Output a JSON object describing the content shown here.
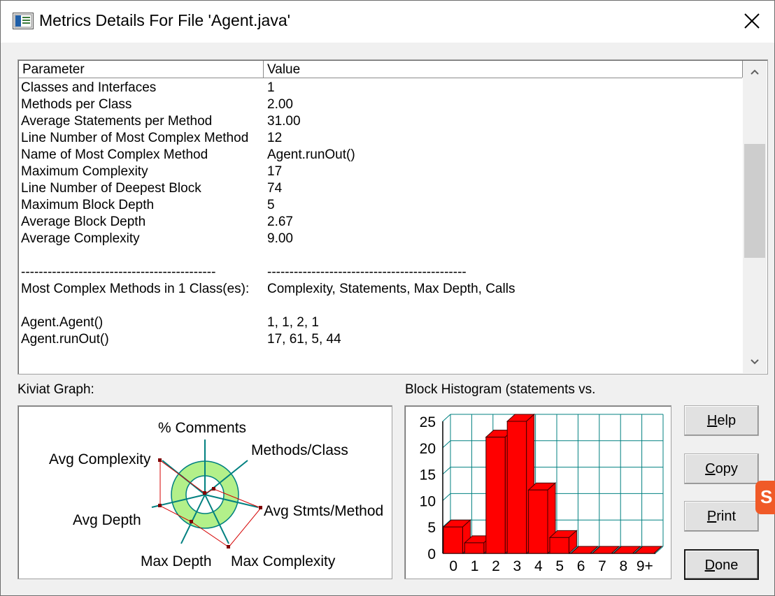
{
  "window": {
    "title": "Metrics Details For File 'Agent.java'",
    "icons": {
      "app": "app-window-icon",
      "close": "close-icon"
    }
  },
  "table": {
    "headers": {
      "parameter": "Parameter",
      "value": "Value"
    },
    "rows": [
      {
        "param": "Classes and Interfaces",
        "value": "1"
      },
      {
        "param": "Methods per Class",
        "value": "2.00"
      },
      {
        "param": "Average Statements per Method",
        "value": "31.00"
      },
      {
        "param": "Line Number of Most Complex Method",
        "value": "12"
      },
      {
        "param": "Name of Most Complex Method",
        "value": "Agent.runOut()"
      },
      {
        "param": "Maximum Complexity",
        "value": "17"
      },
      {
        "param": "Line Number of Deepest Block",
        "value": "74"
      },
      {
        "param": "Maximum Block Depth",
        "value": "5"
      },
      {
        "param": "Average Block Depth",
        "value": "2.67"
      },
      {
        "param": "Average Complexity",
        "value": "9.00"
      },
      {
        "param": "",
        "value": ""
      },
      {
        "param": "--------------------------------------------",
        "value": "---------------------------------------------"
      },
      {
        "param": "Most Complex Methods in 1 Class(es):",
        "value": "Complexity, Statements, Max Depth, Calls"
      },
      {
        "param": "",
        "value": ""
      },
      {
        "param": "Agent.Agent()",
        "value": "1, 1, 2, 1"
      },
      {
        "param": "Agent.runOut()",
        "value": "17, 61, 5, 44"
      }
    ],
    "scrollbar_icons": {
      "up": "chevron-up-icon",
      "down": "chevron-down-icon"
    }
  },
  "kiviat": {
    "label": "Kiviat Graph:",
    "axes": [
      "% Comments",
      "Methods/Class",
      "Avg Stmts/Method",
      "Max Complexity",
      "Max Depth",
      "Avg Depth",
      "Avg Complexity"
    ],
    "colors": {
      "ring": "#b3f08a",
      "ring_edge": "#008080",
      "spokes": "#008080",
      "polygon": "#d40000"
    }
  },
  "histogram": {
    "label": "Block Histogram (statements vs.",
    "colors": {
      "bar": "#ff0000",
      "bar_edge": "#400000",
      "grid": "#008080"
    }
  },
  "buttons": {
    "help": {
      "accel": "H",
      "rest": "elp"
    },
    "copy": {
      "accel": "C",
      "rest": "opy"
    },
    "print": {
      "accel": "P",
      "rest": "rint"
    },
    "done": {
      "accel": "D",
      "rest": "one"
    }
  },
  "side_badge": {
    "text": "S",
    "color": "#f05a28"
  },
  "chart_data": {
    "type": "bar",
    "categories": [
      "0",
      "1",
      "2",
      "3",
      "4",
      "5",
      "6",
      "7",
      "8",
      "9+"
    ],
    "values": [
      5,
      2,
      22,
      25,
      12,
      3,
      0,
      0,
      0,
      0
    ],
    "ylim": [
      0,
      25
    ],
    "yticks": [
      "0",
      "5",
      "10",
      "15",
      "20",
      "25"
    ],
    "grid": true,
    "three_d": true
  }
}
